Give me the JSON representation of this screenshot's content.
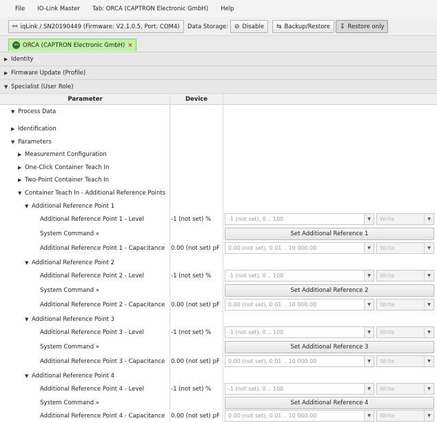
{
  "menu": [
    "File",
    "IO-Link Master",
    "Tab: ORCA (CAPTRON Electronic GmbH)",
    "Help"
  ],
  "toolbar": {
    "connection_label": "iqLink / SN20190449 (Firmware: V2.1.0.5, Port: COM4)",
    "data_storage_label": "Data Storage:",
    "disable_label": "Disable",
    "backup_restore_label": "Backup/Restore",
    "restore_only_label": "Restore only"
  },
  "device_tab": {
    "label": "ORCA (CAPTRON Electronic GmbH)",
    "close": "×"
  },
  "sections": {
    "identity": "Identity",
    "firmware_update": "Firmware Update (Profile)",
    "specialist": "Specialist (User Role)"
  },
  "table": {
    "col_parameter": "Parameter",
    "col_device": "Device"
  },
  "tree": {
    "process_data": "Process Data",
    "identification": "Identification",
    "parameters": "Parameters",
    "measurement_configuration": "Measurement Configuration",
    "one_click": "One-Click Container Teach In",
    "two_point": "Two-Point Container Teach In",
    "additional_ref": "Container Teach In - Additional Reference Points"
  },
  "points": [
    {
      "title": "Additional Reference Point 1",
      "level_label": "Additional Reference Point 1 - Level",
      "level_value": "-1 (not set) %",
      "level_combo": "-1 (not set), 0 .. 100",
      "cmd_label": "System Command »",
      "cmd_button": "Set Additional Reference 1",
      "cap_label": "Additional Reference Point 1 - Capacitance",
      "cap_value": "0.00 (not set) pF",
      "cap_combo": "0.00 (not set), 0.01 .. 10 000.00",
      "write": "Write"
    },
    {
      "title": "Additional Reference Point 2",
      "level_label": "Additional Reference Point 2 - Level",
      "level_value": "-1 (not set) %",
      "level_combo": "-1 (not set), 0 .. 100",
      "cmd_label": "System Command »",
      "cmd_button": "Set Additional Reference 2",
      "cap_label": "Additional Reference Point 2 - Capacitance",
      "cap_value": "0.00 (not set) pF",
      "cap_combo": "0.00 (not set), 0.01 .. 10 000.00",
      "write": "Write"
    },
    {
      "title": "Additional Reference Point 3",
      "level_label": "Additional Reference Point 3 - Level",
      "level_value": "-1 (not set) %",
      "level_combo": "-1 (not set), 0 .. 100",
      "cmd_label": "System Command »",
      "cmd_button": "Set Additional Reference 3",
      "cap_label": "Additional Reference Point 3 - Capacitance",
      "cap_value": "0.00 (not set) pF",
      "cap_combo": "0.00 (not set), 0.01 .. 10 000.00",
      "write": "Write"
    },
    {
      "title": "Additional Reference Point 4",
      "level_label": "Additional Reference Point 4 - Level",
      "level_value": "-1 (not set) %",
      "level_combo": "-1 (not set), 0 .. 100",
      "cmd_label": "System Command »",
      "cmd_button": "Set Additional Reference 4",
      "cap_label": "Additional Reference Point 4 - Capacitance",
      "cap_value": "0.00 (not set) pF",
      "cap_combo": "0.00 (not set), 0.01 .. 10 000.00",
      "write": "Write"
    }
  ],
  "colors": {
    "tab_active": "#bff2a6",
    "tab_border": "#7fd35a"
  }
}
